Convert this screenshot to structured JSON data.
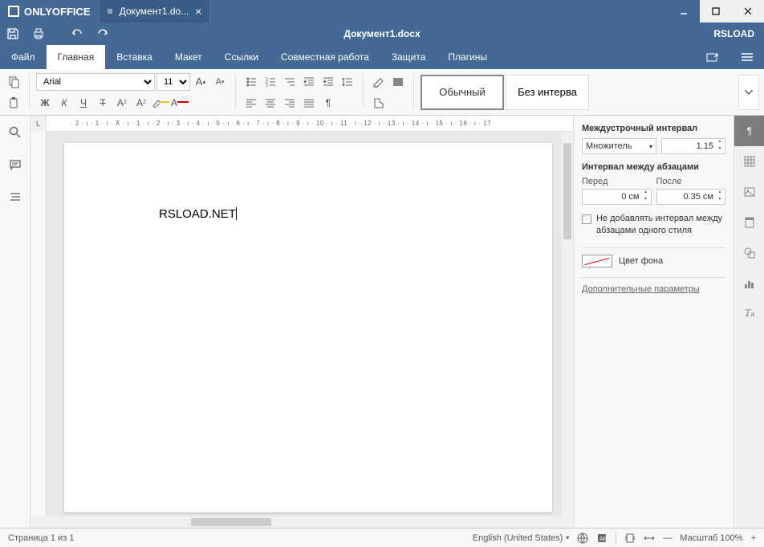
{
  "app": {
    "name": "ONLYOFFICE"
  },
  "tab": {
    "title": "Документ1.do...",
    "icon": "≡"
  },
  "doc": {
    "title": "Документ1.docx",
    "content": "RSLOAD.NET"
  },
  "user": "RSLOAD",
  "menu": {
    "file": "Файл",
    "home": "Главная",
    "insert": "Вставка",
    "layout": "Макет",
    "links": "Ссылки",
    "collab": "Совместная работа",
    "protect": "Защита",
    "plugins": "Плагины"
  },
  "font": {
    "name": "Arial",
    "size": "11"
  },
  "styles": {
    "normal": "Обычный",
    "nospacing": "Без интерва"
  },
  "panel": {
    "line_spacing_title": "Междустрочный интервал",
    "multiplier": "Множитель",
    "multiplier_val": "1.15",
    "para_spacing_title": "Интервал между абзацами",
    "before": "Перед",
    "before_val": "0 см",
    "after": "После",
    "after_val": "0.35 см",
    "no_add_space": "Не добавлять интервал между абзацами одного стиля",
    "bg_color": "Цвет фона",
    "more": "Дополнительные параметры"
  },
  "status": {
    "page": "Страница 1 из 1",
    "lang": "English (United States)",
    "zoom": "Масштаб 100%"
  },
  "ruler": "· 2 · ı · 1 · ı · ⊼ · ı · 1 · ı · 2 · ı · 3 · ı · 4 · ı · 5 · ı · 6 · ı · 7 · ı · 8 · ı · 9 · ı · 10 · ı · 11 · ı · 12 · ı · 13 · ı · 14 · ı · 15 · ı · 16 · ı · 17"
}
